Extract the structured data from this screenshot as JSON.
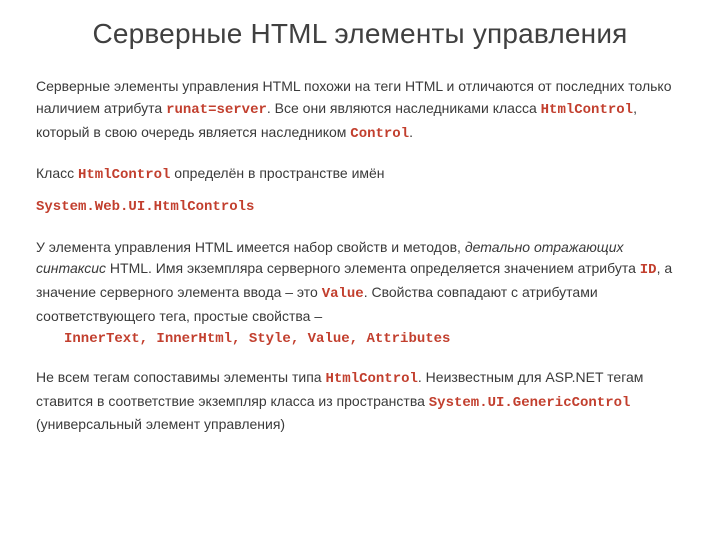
{
  "title": "Серверные HTML элементы управления",
  "p1": {
    "a": "Серверные элементы управления HTML похожи на теги HTML и отличаются от последних только наличием атрибута ",
    "b": "runat=server",
    "c": ".  Все они являются наследниками класса ",
    "d": "HtmlControl",
    "e": ", который в свою очередь является наследником ",
    "f": "Control",
    "g": "."
  },
  "p2": {
    "a": "Класс ",
    "b": "HtmlControl",
    "c": " определён в пространстве имён"
  },
  "p3": "System.Web.UI.HtmlControls",
  "p4": {
    "a": "У элемента управления HTML имеется набор свойств и методов, ",
    "b": "детально отражающих синтаксис",
    "c": " HTML. Имя экземпляра серверного элемента определяется значением атрибута ",
    "d": "ID",
    "e": ", а значение серверного элемента ввода – это ",
    "f": "Value",
    "g": ". Свойства совпадают с атрибутами соответствующего тега, простые свойства –"
  },
  "p4_list": "InnerText, InnerHtml, Style, Value, Attributes",
  "p5": {
    "a": "Не всем тегам сопоставимы элементы типа ",
    "b": "HtmlControl",
    "c": ". Неизвестным для ASP.NET тегам ставится в соответствие экземпляр класса из пространства ",
    "d": "System.UI.GenericControl",
    "e": " (универсальный элемент управления)"
  }
}
